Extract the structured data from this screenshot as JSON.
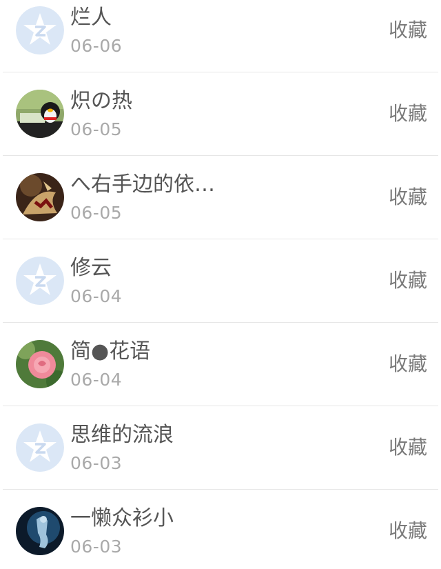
{
  "list": {
    "items": [
      {
        "name": "烂人",
        "date": "06-06",
        "action": "收藏",
        "avatar": "default-qzone-avatar"
      },
      {
        "name": "炽の热",
        "date": "06-05",
        "action": "收藏",
        "avatar": "qq-penguin-photo"
      },
      {
        "name": "へ右手边的依…",
        "date": "06-05",
        "action": "收藏",
        "avatar": "dragon-photo"
      },
      {
        "name": "修云",
        "date": "06-04",
        "action": "收藏",
        "avatar": "default-qzone-avatar"
      },
      {
        "name": "简●花语",
        "date": "06-04",
        "action": "收藏",
        "avatar": "pink-flower-photo"
      },
      {
        "name": "思维的流浪",
        "date": "06-03",
        "action": "收藏",
        "avatar": "default-qzone-avatar"
      },
      {
        "name": "一懒众衫小",
        "date": "06-03",
        "action": "收藏",
        "avatar": "dark-blue-photo"
      }
    ]
  },
  "colors": {
    "name_text": "#555555",
    "date_text": "#a9a9a9",
    "action_text": "#7a7a7a",
    "divider": "#e6e6e6",
    "default_avatar": "#dbe7f6"
  }
}
